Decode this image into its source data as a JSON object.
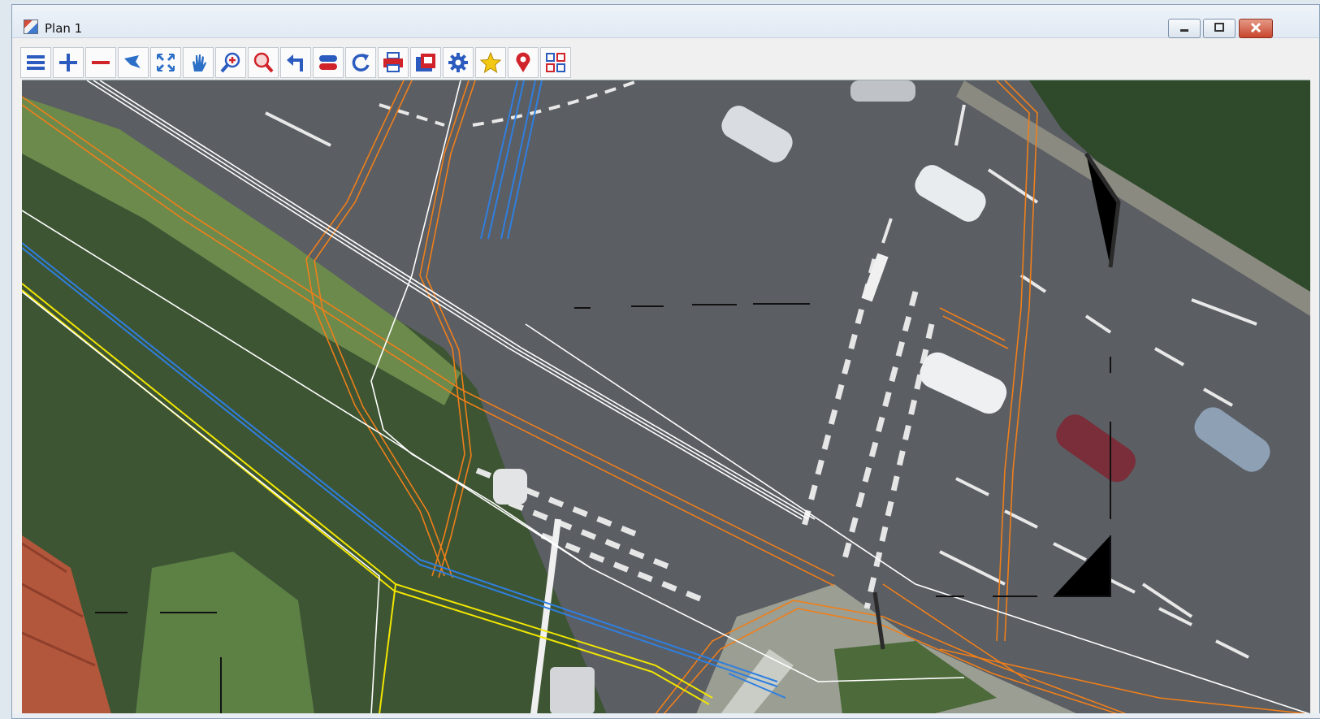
{
  "window": {
    "title": "Plan 1",
    "controls": [
      "minimize",
      "maximize",
      "close"
    ]
  },
  "toolbar": {
    "buttons": [
      {
        "icon": "menu-icon",
        "action": "menu"
      },
      {
        "icon": "zoom-in-plus-icon",
        "action": "zoom-in"
      },
      {
        "icon": "zoom-out-minus-icon",
        "action": "zoom-out"
      },
      {
        "icon": "fit-icon",
        "action": "fit"
      },
      {
        "icon": "extent-icon",
        "action": "extent"
      },
      {
        "icon": "pan-hand-icon",
        "action": "pan"
      },
      {
        "icon": "zoom-window-icon",
        "action": "zoom-window"
      },
      {
        "icon": "zoom-previous-icon",
        "action": "zoom-previous"
      },
      {
        "icon": "undo-view-icon",
        "action": "previous-view"
      },
      {
        "icon": "toggle-icon",
        "action": "toggle"
      },
      {
        "icon": "redraw-icon",
        "action": "redraw"
      },
      {
        "icon": "print-icon",
        "action": "print"
      },
      {
        "icon": "plot-icon",
        "action": "plot"
      },
      {
        "icon": "settings-gear-icon",
        "action": "settings"
      },
      {
        "icon": "favorite-star-icon",
        "action": "favorites"
      },
      {
        "icon": "location-pin-icon",
        "action": "locate"
      },
      {
        "icon": "views-grid-icon",
        "action": "views"
      }
    ]
  },
  "colors": {
    "orange_lines": "#f07f1a",
    "blue_lines": "#2f7fe0",
    "yellow_lines": "#f2e600",
    "white_lines": "#ffffff",
    "road": "#5a5d62",
    "vegetation": "#3f5a34",
    "grass": "#6f8b4e",
    "roof": "#b3573c"
  }
}
